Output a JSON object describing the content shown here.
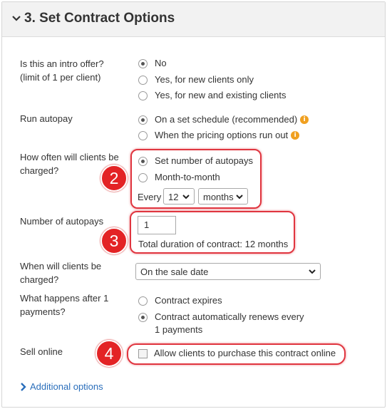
{
  "section": {
    "title": "3. Set Contract Options"
  },
  "intro_offer": {
    "label": "Is this an intro offer?\n(limit of 1 per client)",
    "options": [
      "No",
      "Yes, for new clients only",
      "Yes, for new and existing clients"
    ],
    "selected": "No"
  },
  "autopay": {
    "label": "Run autopay",
    "options": [
      "On a set schedule (recommended)",
      "When the pricing options run out"
    ],
    "selected": "On a set schedule (recommended)",
    "info_glyph": "i"
  },
  "charge_frequency": {
    "label": "How often will clients be charged?",
    "options": [
      "Set number of autopays",
      "Month-to-month"
    ],
    "selected": "Set number of autopays",
    "every_label": "Every",
    "interval_value": "12",
    "interval_unit": "months"
  },
  "number_of_autopays": {
    "label": "Number of autopays",
    "value": "1",
    "duration_text": "Total duration of contract: 12 months"
  },
  "charge_date": {
    "label": "When will clients be charged?",
    "selected": "On the sale date"
  },
  "after_payments": {
    "label": "What happens after 1 payments?",
    "options": [
      "Contract expires",
      "Contract automatically renews every 1 payments"
    ],
    "selected": "Contract automatically renews every 1 payments"
  },
  "sell_online": {
    "label": "Sell online",
    "checkbox_label": "Allow clients to purchase this contract online",
    "checked": false
  },
  "callouts": [
    "2",
    "3",
    "4"
  ],
  "additional_options": {
    "label": "Additional options"
  },
  "colors": {
    "highlight": "#e0353f",
    "badge": "#e32325",
    "link": "#2a6ebb",
    "info": "#f0a020"
  },
  "icons": [
    "chevron-down-icon",
    "info-icon",
    "chevron-right-icon",
    "caret-down-icon"
  ]
}
